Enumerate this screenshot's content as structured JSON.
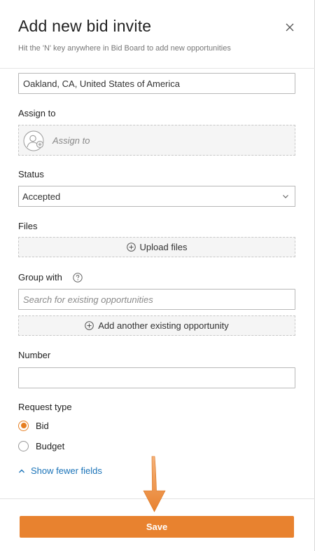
{
  "header": {
    "title": "Add new bid invite",
    "subtitle": "Hit the 'N' key anywhere in Bid Board to add new opportunities"
  },
  "location": {
    "value": "Oakland, CA, United States of America"
  },
  "assign_to": {
    "label": "Assign to",
    "placeholder": "Assign to"
  },
  "status": {
    "label": "Status",
    "selected": "Accepted"
  },
  "files": {
    "label": "Files",
    "upload_label": "Upload files"
  },
  "group_with": {
    "label": "Group with",
    "search_placeholder": "Search for existing opportunities",
    "add_label": "Add another existing opportunity"
  },
  "number": {
    "label": "Number",
    "value": ""
  },
  "request_type": {
    "label": "Request type",
    "options": [
      {
        "label": "Bid",
        "checked": true
      },
      {
        "label": "Budget",
        "checked": false
      }
    ]
  },
  "show_fewer_label": "Show fewer fields",
  "footer": {
    "save_label": "Save"
  },
  "colors": {
    "accent": "#e8822f",
    "link": "#1a73b8"
  },
  "icons": [
    "close-icon",
    "user-add-icon",
    "chevron-down-icon",
    "plus-circle-icon",
    "help-icon",
    "chevron-up-icon",
    "arrow-down-annotation"
  ]
}
